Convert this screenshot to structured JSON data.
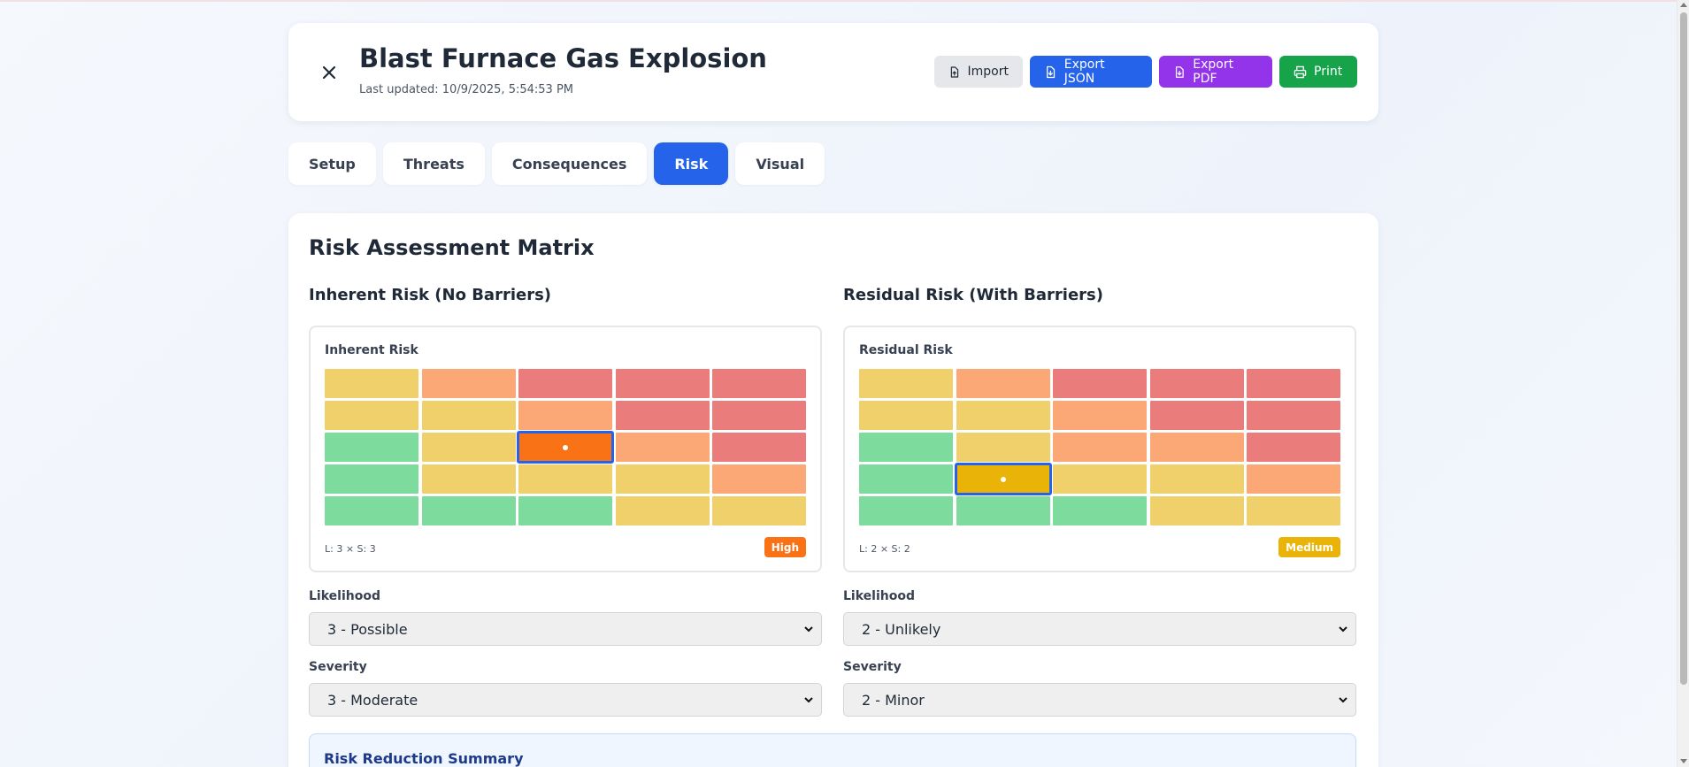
{
  "header": {
    "title": "Blast Furnace Gas Explosion",
    "last_updated": "Last updated: 10/9/2025, 5:54:53 PM",
    "import_label": "Import",
    "export_json_label": "Export JSON",
    "export_pdf_label": "Export PDF",
    "print_label": "Print",
    "icons": {
      "close": "close-icon",
      "import": "file-upload-icon",
      "export_json": "file-download-icon",
      "export_pdf": "file-download-icon",
      "print": "printer-icon"
    }
  },
  "tabs": [
    {
      "label": "Setup",
      "active": false
    },
    {
      "label": "Threats",
      "active": false
    },
    {
      "label": "Consequences",
      "active": false
    },
    {
      "label": "Risk",
      "active": true
    },
    {
      "label": "Visual",
      "active": false
    }
  ],
  "risk": {
    "title": "Risk Assessment Matrix",
    "inherent": {
      "heading": "Inherent Risk (No Barriers)",
      "matrix_label": "Inherent Risk",
      "footer": "L: 3 × S: 3",
      "level": "High",
      "level_color": "#f97316",
      "likelihood_label": "Likelihood",
      "likelihood_value": "3 - Possible",
      "severity_label": "Severity",
      "severity_value": "3 - Moderate",
      "selected_likelihood": 3,
      "selected_severity": 3,
      "selected_color": "#f97316"
    },
    "residual": {
      "heading": "Residual Risk (With Barriers)",
      "matrix_label": "Residual Risk",
      "footer": "L: 2 × S: 2",
      "level": "Medium",
      "level_color": "#eab308",
      "likelihood_label": "Likelihood",
      "likelihood_value": "2 - Unlikely",
      "severity_label": "Severity",
      "severity_value": "2 - Minor",
      "selected_likelihood": 2,
      "selected_severity": 2,
      "selected_color": "#eab308"
    },
    "matrix_rows": [
      [
        "medium",
        "high",
        "critical",
        "critical",
        "critical"
      ],
      [
        "medium",
        "medium",
        "high",
        "critical",
        "critical"
      ],
      [
        "low",
        "medium",
        "high",
        "high",
        "critical"
      ],
      [
        "low",
        "medium",
        "medium",
        "medium",
        "high"
      ],
      [
        "low",
        "low",
        "low",
        "medium",
        "medium"
      ]
    ],
    "level_colors": {
      "low": "#7ddc9d",
      "medium": "#f0d06a",
      "high": "#fba876",
      "critical": "#ea7c7c"
    },
    "summary_title": "Risk Reduction Summary"
  }
}
